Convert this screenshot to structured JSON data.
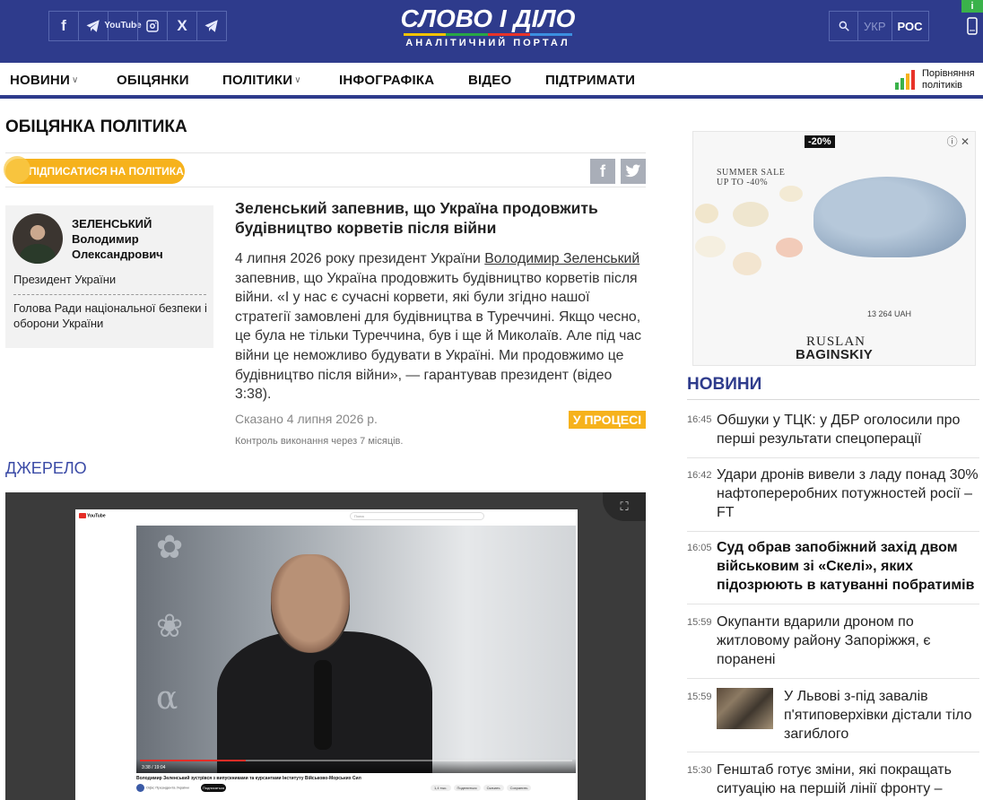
{
  "header": {
    "social": [
      "f",
      "telegram",
      "YouTube",
      "instagram",
      "X",
      "telegram"
    ],
    "logo_main": "СЛОВО І ДІЛО",
    "logo_sub": "АНАЛІТИЧНИЙ ПОРТАЛ",
    "lang_ukr": "УКР",
    "lang_ros": "РОС",
    "corner_badge": "і"
  },
  "nav": {
    "items": [
      "НОВИНИ",
      "ОБІЦЯНКИ",
      "ПОЛІТИКИ",
      "ІНФОГРАФІКА",
      "ВІДЕО",
      "ПІДТРИМАТИ"
    ],
    "compare_line1": "Порівняння",
    "compare_line2": "політиків"
  },
  "page": {
    "title": "ОБІЦЯНКА ПОЛІТИКА",
    "subscribe": "ПІДПИСАТИСЯ НА ПОЛІТИКА",
    "share_fb": "f",
    "share_tw": "t"
  },
  "politician": {
    "surname": "ЗЕЛЕНСЬКИЙ",
    "name1": "Володимир",
    "name2": "Олександрович",
    "position": "Президент України",
    "role": "Голова Ради національної безпеки і оборони України"
  },
  "article": {
    "headline": "Зеленський запевнив, що Україна продовжить будівництво корветів після війни",
    "body_pre": "4 липня 2026 року президент України ",
    "body_link": "Володимир Зеленський",
    "body_post": " запевнив, що Україна продовжить будівництво корветів після війни. «І у нас є сучасні корвети, які були згідно нашої стратегії замовлені для будівництва в Туреччині. Якщо чесно, це була не тільки Туреччина, був і ще й Миколаїв. Але під час війни це неможливо будувати в Україні. Ми продовжимо це будівництво після війни», — гарантував президент (відео 3:38).",
    "said": "Сказано 4 липня 2026 р.",
    "status": "У ПРОЦЕСІ",
    "control": "Контроль виконання через 7 місяців."
  },
  "source": {
    "label": "ДЖЕРЕЛО",
    "video": {
      "yt_logo": "YouTube",
      "search_placeholder": "Поиск",
      "time": "3:38 / 19:04",
      "caption": "Володимир Зеленський зустрівся з випускниками та курсантами Інституту Військово-Морських Сил",
      "channel": "Офіс Президента України",
      "subscribe": "Подписаться",
      "actions": [
        "1,4 тыс.",
        "Поделиться",
        "Скачать",
        "Сохранить"
      ]
    }
  },
  "ad": {
    "discount": "-20%",
    "sale": "SUMMER SALE UP TO -40%",
    "price": "13 264 UAH",
    "brand1": "RUSLAN",
    "brand2": "BAGINSKIY"
  },
  "news": {
    "title": "НОВИНИ",
    "items": [
      {
        "time": "16:45",
        "text": "Обшуки у ТЦК: у ДБР оголосили про перші результати спецоперації",
        "bold": false
      },
      {
        "time": "16:42",
        "text": "Удари дронів вивели з ладу понад 30% нафтопереробних потужностей росії – FT",
        "bold": false
      },
      {
        "time": "16:05",
        "text": "Суд обрав запобіжний захід двом військовим зі «Скелі», яких підозрюють в катуванні побратимів",
        "bold": true
      },
      {
        "time": "15:59",
        "text": "Окупанти вдарили дроном по житловому району Запоріжжя, є поранені",
        "bold": false
      },
      {
        "time": "15:59",
        "text": "У Львові з-під завалів п'ятиповерхівки дістали тіло загиблого",
        "bold": false
      },
      {
        "time": "15:30",
        "text": "Генштаб готує зміни, які покращать ситуацію на першій лінії фронту –",
        "bold": false
      }
    ]
  },
  "colors": {
    "header_bg": "#2e3b8c",
    "accent_yellow": "#f6b21c",
    "link_blue": "#3a4aa6"
  }
}
